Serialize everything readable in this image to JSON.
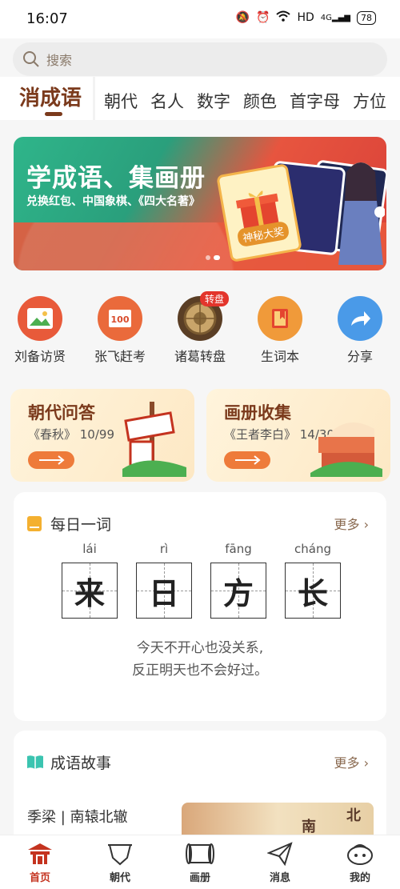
{
  "status_bar": {
    "time": "16:07",
    "network": "HD",
    "signal_label": "4G",
    "battery": "78"
  },
  "search": {
    "placeholder": "搜索"
  },
  "tabs": {
    "active": "消成语",
    "items": [
      "朝代",
      "名人",
      "数字",
      "颜色",
      "首字母",
      "方位"
    ]
  },
  "banner": {
    "title": "学成语、集画册",
    "subtitle": "兑换红包、中国象棋、《四大名著》",
    "prize_label": "神秘大奖",
    "page_count": 2,
    "active_page": 2
  },
  "quick_menu": [
    {
      "label": "刘备访贤",
      "icon": "photo-frame-icon",
      "color": "#e85a3a"
    },
    {
      "label": "张飞赶考",
      "icon": "exam-scroll-icon",
      "color": "#ea6a3b"
    },
    {
      "label": "诸葛转盘",
      "icon": "wheel-icon",
      "color": "#6a4a2a",
      "badge": "转盘"
    },
    {
      "label": "生词本",
      "icon": "book-icon",
      "color": "#f09a3a"
    },
    {
      "label": "分享",
      "icon": "share-icon",
      "color": "#4a9ae8"
    }
  ],
  "cards": [
    {
      "title": "朝代问答",
      "subtitle": "《春秋》 10/99"
    },
    {
      "title": "画册收集",
      "subtitle": "《王者李白》 14/30"
    }
  ],
  "daily_word": {
    "title": "每日一词",
    "more": "更多 ›",
    "chars": [
      {
        "pinyin": "lái",
        "char": "来"
      },
      {
        "pinyin": "rì",
        "char": "日"
      },
      {
        "pinyin": "fāng",
        "char": "方"
      },
      {
        "pinyin": "cháng",
        "char": "长"
      }
    ],
    "quote_line1": "今天不开心也没关系,",
    "quote_line2": "反正明天也不会好过。"
  },
  "story": {
    "title": "成语故事",
    "more": "更多 ›",
    "first_item": "季梁 | 南辕北辙",
    "thumb_text1": "南",
    "thumb_text2": "北"
  },
  "nav": [
    {
      "label": "首页",
      "active": true
    },
    {
      "label": "朝代",
      "active": false
    },
    {
      "label": "画册",
      "active": false
    },
    {
      "label": "消息",
      "active": false
    },
    {
      "label": "我的",
      "active": false
    }
  ]
}
